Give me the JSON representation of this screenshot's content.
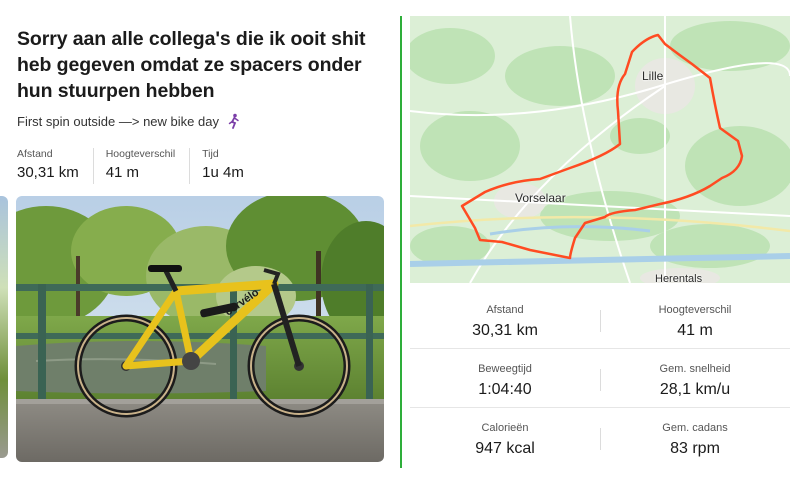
{
  "post": {
    "title": "Sorry aan alle collega's die ik ooit shit heb gegeven omdat ze spacers onder hun stuurpen hebben",
    "subtitle": "First spin outside —> new bike day",
    "stats": [
      {
        "label": "Afstand",
        "value": "30,31 km"
      },
      {
        "label": "Hoogteverschil",
        "value": "41 m"
      },
      {
        "label": "Tijd",
        "value": "1u 4m"
      }
    ],
    "photo_brand": "cervélo"
  },
  "map": {
    "labels": {
      "north_town": "Lille",
      "west_town": "Vorselaar",
      "south_town": "Herentals"
    },
    "route_color": "#ff4b22",
    "water_color": "#a9cfe8",
    "land_color": "#dcefd6",
    "forest_color": "#bfe3b6"
  },
  "activity_stats": [
    [
      {
        "label": "Afstand",
        "value": "30,31 km"
      },
      {
        "label": "Hoogteverschil",
        "value": "41 m"
      }
    ],
    [
      {
        "label": "Beweegtijd",
        "value": "1:04:40"
      },
      {
        "label": "Gem. snelheid",
        "value": "28,1 km/u"
      }
    ],
    [
      {
        "label": "Calorieën",
        "value": "947 kcal"
      },
      {
        "label": "Gem. cadans",
        "value": "83 rpm"
      }
    ]
  ],
  "colors": {
    "divider": "#2eae3a",
    "bike_yellow": "#e8c21c"
  }
}
